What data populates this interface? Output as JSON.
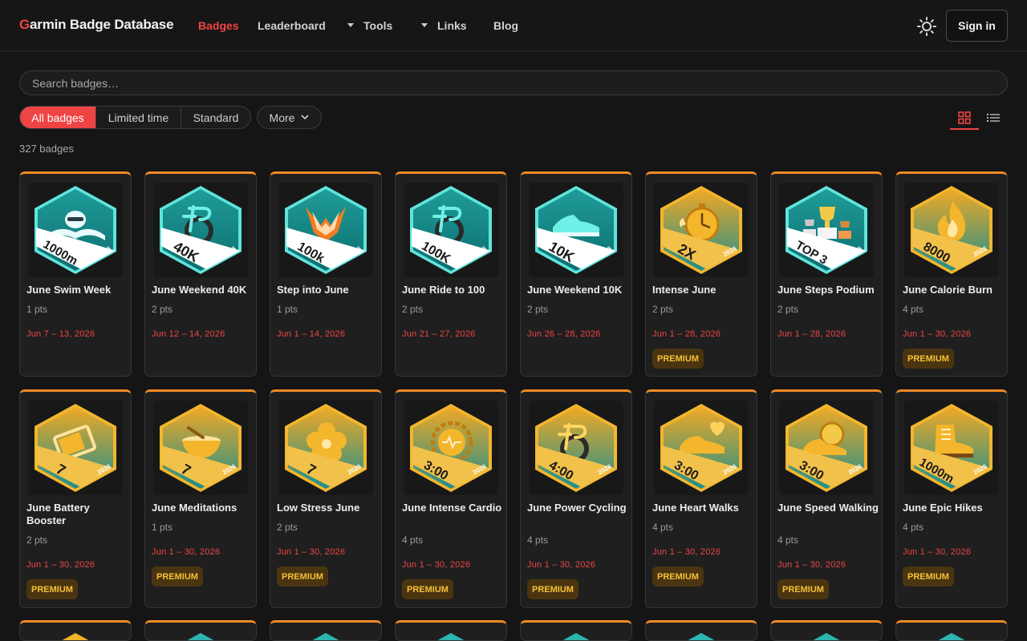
{
  "header": {
    "brand_first": "G",
    "brand_rest": "armin Badge Database",
    "nav": [
      {
        "label": "Badges",
        "active": true
      },
      {
        "label": "Leaderboard"
      },
      {
        "label": "Tools",
        "dropdown": true
      },
      {
        "label": "Links",
        "dropdown": true
      },
      {
        "label": "Blog"
      }
    ],
    "theme_icon": "sun-icon",
    "signin_label": "Sign in"
  },
  "search": {
    "placeholder": "Search badges…",
    "value": ""
  },
  "filters": {
    "segments": [
      "All badges",
      "Limited time",
      "Standard"
    ],
    "active": "All badges",
    "more_label": "More"
  },
  "view": {
    "grid_icon": "grid-icon",
    "list_icon": "list-icon",
    "active": "grid"
  },
  "count_label": "327 badges",
  "colors": {
    "accent": "#ef4444",
    "card_top": "#f08a24",
    "premium_text": "#f6c036",
    "teal": "#2cb5b0",
    "gold": "#f0b429"
  },
  "badges": [
    {
      "name": "June Swim Week",
      "pts": "1 pts",
      "dates": "Jun 7 – 13, 2026",
      "premium": false,
      "value": "1000m",
      "year": "2026",
      "style": "teal",
      "icon": "swimmer-icon"
    },
    {
      "name": "June Weekend 40K",
      "pts": "2 pts",
      "dates": "Jun 12 – 14, 2026",
      "premium": false,
      "value": "40K",
      "year": "2026",
      "style": "teal",
      "icon": "bike-icon"
    },
    {
      "name": "Step into June",
      "pts": "1 pts",
      "dates": "Jun 1 – 14, 2026",
      "premium": false,
      "value": "100k",
      "year": "2026",
      "style": "teal",
      "icon": "chevron-burst-icon"
    },
    {
      "name": "June Ride to 100",
      "pts": "2 pts",
      "dates": "Jun 21 – 27, 2026",
      "premium": false,
      "value": "100K",
      "year": "2026",
      "style": "teal",
      "icon": "bike-icon"
    },
    {
      "name": "June Weekend 10K",
      "pts": "2 pts",
      "dates": "Jun 26 – 28, 2026",
      "premium": false,
      "value": "10K",
      "year": "2026",
      "style": "teal",
      "icon": "shoe-icon"
    },
    {
      "name": "Intense June",
      "pts": "2 pts",
      "dates": "Jun 1 – 28, 2026",
      "premium": true,
      "value": "2X",
      "year": "2026",
      "style": "gold",
      "icon": "stopwatch-icon"
    },
    {
      "name": "June Steps Podium",
      "pts": "2 pts",
      "dates": "Jun 1 – 28, 2026",
      "premium": false,
      "value": "TOP 3",
      "year": "2026",
      "style": "teal",
      "icon": "trophy-icon"
    },
    {
      "name": "June Calorie Burn",
      "pts": "4 pts",
      "dates": "Jun 1 – 30, 2026",
      "premium": true,
      "value": "8000",
      "year": "2026",
      "style": "gold",
      "icon": "flame-icon"
    },
    {
      "name": "June Battery Booster",
      "pts": "2 pts",
      "dates": "Jun 1 – 30, 2026",
      "premium": true,
      "value": "7",
      "year": "2026",
      "style": "gold",
      "icon": "battery-icon"
    },
    {
      "name": "June Meditations",
      "pts": "1 pts",
      "dates": "Jun 1 – 30, 2026",
      "premium": true,
      "value": "7",
      "year": "2026",
      "style": "gold",
      "icon": "singing-bowl-icon"
    },
    {
      "name": "Low Stress June",
      "pts": "2 pts",
      "dates": "Jun 1 – 30, 2026",
      "premium": true,
      "value": "7",
      "year": "2026",
      "style": "gold",
      "icon": "flower-icon"
    },
    {
      "name": "June Intense Cardio",
      "pts": "4 pts",
      "dates": "Jun 1 – 30, 2026",
      "premium": true,
      "value": "3:00",
      "year": "2026",
      "style": "gold",
      "icon": "heart-gear-icon"
    },
    {
      "name": "June Power Cycling",
      "pts": "4 pts",
      "dates": "Jun 1 – 30, 2026",
      "premium": true,
      "value": "4:00",
      "year": "2026",
      "style": "gold",
      "icon": "bike-icon"
    },
    {
      "name": "June Heart Walks",
      "pts": "4 pts",
      "dates": "Jun 1 – 30, 2026",
      "premium": true,
      "value": "3:00",
      "year": "2026",
      "style": "gold",
      "icon": "shoe-heart-icon"
    },
    {
      "name": "June Speed Walking",
      "pts": "4 pts",
      "dates": "Jun 1 – 30, 2026",
      "premium": true,
      "value": "3:00",
      "year": "2026",
      "style": "gold",
      "icon": "shoe-stopwatch-icon"
    },
    {
      "name": "June Epic Hikes",
      "pts": "4 pts",
      "dates": "Jun 1 – 30, 2026",
      "premium": true,
      "value": "1000m",
      "year": "2026",
      "style": "gold",
      "icon": "hiking-boot-icon"
    }
  ],
  "premium_label": "PREMIUM"
}
